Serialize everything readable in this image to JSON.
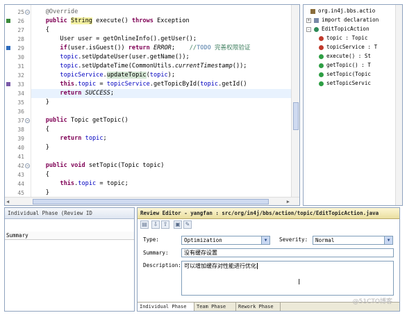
{
  "editor": {
    "lines": [
      {
        "num": "25",
        "fold": true,
        "parts": [
          {
            "t": "    "
          },
          {
            "t": "@Override",
            "c": "ann"
          }
        ]
      },
      {
        "num": "26",
        "parts": [
          {
            "t": "    "
          },
          {
            "t": "public",
            "c": "kw"
          },
          {
            "t": " "
          },
          {
            "t": "String",
            "c": "hl-y"
          },
          {
            "t": " execute() "
          },
          {
            "t": "throws",
            "c": "kw"
          },
          {
            "t": " Exception"
          }
        ]
      },
      {
        "num": "27",
        "parts": [
          {
            "t": "    {"
          }
        ]
      },
      {
        "num": "28",
        "parts": [
          {
            "t": "        User user = getOnlineInfo().getUser();"
          }
        ]
      },
      {
        "num": "29",
        "parts": [
          {
            "t": "        "
          },
          {
            "t": "if",
            "c": "kw"
          },
          {
            "t": "(user.isGuest()) "
          },
          {
            "t": "return",
            "c": "kw"
          },
          {
            "t": " "
          },
          {
            "t": "ERROR",
            "c": "str-it"
          },
          {
            "t": ";    "
          },
          {
            "t": "//",
            "c": "cmt"
          },
          {
            "t": "TODO",
            "c": "todo"
          },
          {
            "t": " 完善权限验证",
            "c": "cmt"
          }
        ]
      },
      {
        "num": "30",
        "parts": [
          {
            "t": "        "
          },
          {
            "t": "topic",
            "c": "field"
          },
          {
            "t": ".setUpdateUser(user.getName());"
          }
        ]
      },
      {
        "num": "31",
        "parts": [
          {
            "t": "        "
          },
          {
            "t": "topic",
            "c": "field"
          },
          {
            "t": ".setUpdateTime(CommonUtils."
          },
          {
            "t": "currentTimestamp",
            "c": "str-it"
          },
          {
            "t": "());"
          }
        ]
      },
      {
        "num": "32",
        "parts": [
          {
            "t": "        "
          },
          {
            "t": "topicService",
            "c": "field"
          },
          {
            "t": "."
          },
          {
            "t": "updateTopic",
            "c": "hl-g"
          },
          {
            "t": "("
          },
          {
            "t": "topic",
            "c": "field"
          },
          {
            "t": ");"
          }
        ]
      },
      {
        "num": "33",
        "parts": [
          {
            "t": "        "
          },
          {
            "t": "this",
            "c": "kw"
          },
          {
            "t": "."
          },
          {
            "t": "topic",
            "c": "field"
          },
          {
            "t": " = "
          },
          {
            "t": "topicService",
            "c": "field"
          },
          {
            "t": ".getTopicById("
          },
          {
            "t": "topic",
            "c": "field"
          },
          {
            "t": ".getId()"
          }
        ]
      },
      {
        "num": "34",
        "current": true,
        "parts": [
          {
            "t": "        "
          },
          {
            "t": "return",
            "c": "kw"
          },
          {
            "t": " "
          },
          {
            "t": "SUCCESS",
            "c": "str-it"
          },
          {
            "t": ";"
          }
        ]
      },
      {
        "num": "35",
        "parts": [
          {
            "t": "    }"
          }
        ]
      },
      {
        "num": "36",
        "parts": [
          {
            "t": ""
          }
        ]
      },
      {
        "num": "37",
        "fold": true,
        "parts": [
          {
            "t": "    "
          },
          {
            "t": "public",
            "c": "kw"
          },
          {
            "t": " Topic getTopic()"
          }
        ]
      },
      {
        "num": "38",
        "parts": [
          {
            "t": "    {"
          }
        ]
      },
      {
        "num": "39",
        "parts": [
          {
            "t": "        "
          },
          {
            "t": "return",
            "c": "kw"
          },
          {
            "t": " "
          },
          {
            "t": "topic",
            "c": "field"
          },
          {
            "t": ";"
          }
        ]
      },
      {
        "num": "40",
        "parts": [
          {
            "t": "    }"
          }
        ]
      },
      {
        "num": "41",
        "parts": [
          {
            "t": ""
          }
        ]
      },
      {
        "num": "42",
        "fold": true,
        "parts": [
          {
            "t": "    "
          },
          {
            "t": "public",
            "c": "kw"
          },
          {
            "t": " "
          },
          {
            "t": "void",
            "c": "kw"
          },
          {
            "t": " setTopic(Topic topic)"
          }
        ]
      },
      {
        "num": "43",
        "parts": [
          {
            "t": "    {"
          }
        ]
      },
      {
        "num": "44",
        "parts": [
          {
            "t": "        "
          },
          {
            "t": "this",
            "c": "kw"
          },
          {
            "t": "."
          },
          {
            "t": "topic",
            "c": "field"
          },
          {
            "t": " = topic;"
          }
        ]
      },
      {
        "num": "45",
        "parts": [
          {
            "t": "    }"
          }
        ]
      }
    ]
  },
  "outline": {
    "items": [
      {
        "label": "org.in4j.bbs.actio",
        "icon": "package-icon",
        "color": "#8a6d3b",
        "toggle": ""
      },
      {
        "label": "import declaration",
        "icon": "imports-icon",
        "color": "#7a8aa8",
        "toggle": "+"
      },
      {
        "label": "EditTopicAction",
        "icon": "class-icon",
        "color": "#2e8b57",
        "toggle": "-"
      },
      {
        "label": "topic : Topic",
        "icon": "field-private-icon",
        "color": "#c0392b",
        "toggle": ""
      },
      {
        "label": "topicService : T",
        "icon": "field-private-icon",
        "color": "#c0392b",
        "toggle": ""
      },
      {
        "label": "execute() : St",
        "icon": "method-public-icon",
        "color": "#2e9e44",
        "toggle": ""
      },
      {
        "label": "getTopic() : T",
        "icon": "method-public-icon",
        "color": "#2e9e44",
        "toggle": ""
      },
      {
        "label": "setTopic(Topic",
        "icon": "method-public-icon",
        "color": "#2e9e44",
        "toggle": ""
      },
      {
        "label": "setTopicServic",
        "icon": "method-public-icon",
        "color": "#2e9e44",
        "toggle": ""
      }
    ]
  },
  "phase_panel": {
    "tab": "Individual Phase (Review ID",
    "column": "Summary"
  },
  "review": {
    "tab": "Review Editor - yangfan : src/org/in4j/bbs/action/topic/EditTopicAction.java",
    "type_label": "Type:",
    "type_value": "Optimization",
    "severity_label": "Severity:",
    "severity_value": "Normal",
    "summary_label": "Summary:",
    "summary_value": "没有缓存设置",
    "description_label": "Description:",
    "description_value": "可以增加缓存对性能进行优化",
    "bottom_tabs": [
      "Individual Phase",
      "Team Phase",
      "Rework Phase"
    ]
  },
  "watermark": "@51CTO博客",
  "colors": {
    "keyword": "#7f0055",
    "field": "#0000c0",
    "comment": "#3f7f5f",
    "annotation": "#646464",
    "review_tab": "#eadfa0"
  }
}
